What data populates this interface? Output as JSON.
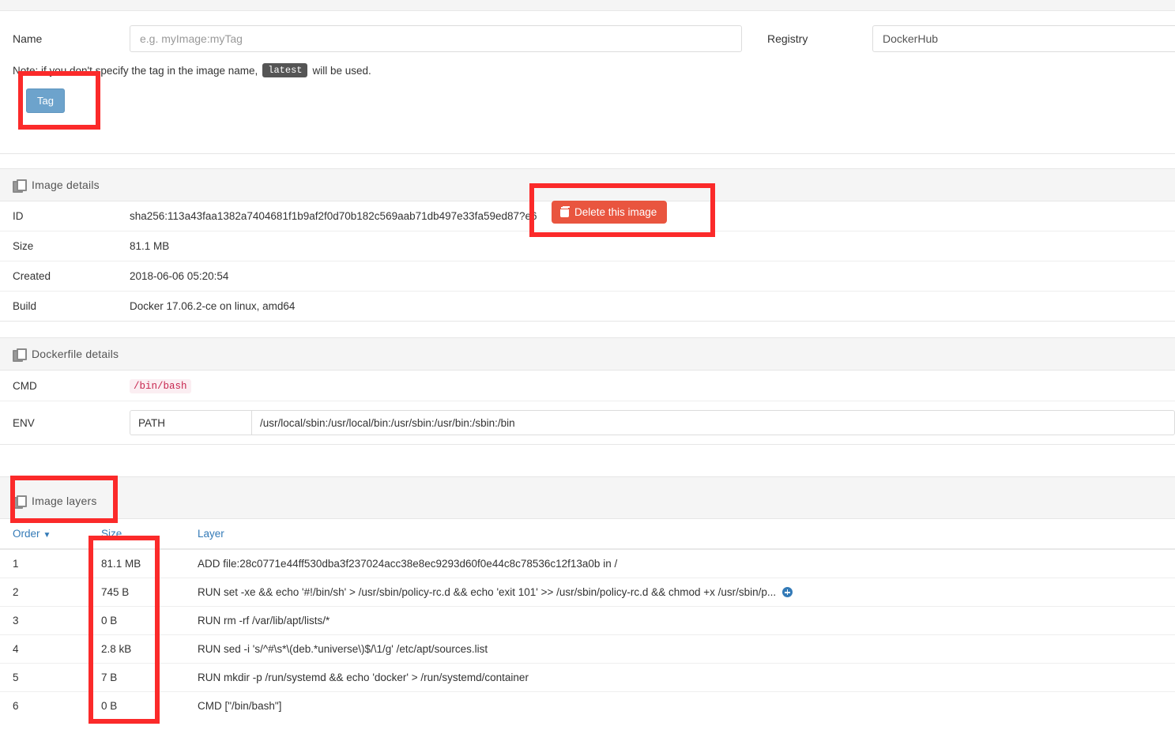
{
  "form": {
    "name_label": "Name",
    "name_placeholder": "e.g. myImage:myTag",
    "name_value": "",
    "registry_label": "Registry",
    "registry_value": "DockerHub",
    "note_prefix": "Note: if you don't specify the tag in the image name,",
    "note_badge": "latest",
    "note_suffix": "will be used.",
    "tag_button": "Tag"
  },
  "image_details": {
    "heading": "Image details",
    "heading_icon": "clone-icon",
    "delete_button": "Delete this image",
    "delete_icon": "trash-icon",
    "rows": [
      {
        "key": "ID",
        "value": "sha256:113a43faa1382a7404681f1b9af2f0d70b182c569aab71db497e33fa59ed87?e6"
      },
      {
        "key": "Size",
        "value": "81.1 MB"
      },
      {
        "key": "Created",
        "value": "2018-06-06 05:20:54"
      },
      {
        "key": "Build",
        "value": "Docker 17.06.2-ce on linux, amd64"
      }
    ]
  },
  "dockerfile_details": {
    "heading": "Dockerfile details",
    "heading_icon": "clone-icon",
    "cmd_label": "CMD",
    "cmd_value": "/bin/bash",
    "env_label": "ENV",
    "env_key": "PATH",
    "env_value": "/usr/local/sbin:/usr/local/bin:/usr/sbin:/usr/bin:/sbin:/bin"
  },
  "image_layers": {
    "heading": "Image layers",
    "heading_icon": "clone-icon",
    "columns": {
      "order": "Order",
      "order_sort_icon": "chevron-down-icon",
      "size": "Size",
      "layer": "Layer"
    },
    "rows": [
      {
        "order": "1",
        "size": "81.1 MB",
        "layer": "ADD file:28c0771e44ff530dba3f237024acc38e8ec9293d60f0e44c8c78536c12f13a0b in /",
        "expandable": false
      },
      {
        "order": "2",
        "size": "745 B",
        "layer": "RUN set -xe && echo '#!/bin/sh' > /usr/sbin/policy-rc.d && echo 'exit 101' >> /usr/sbin/policy-rc.d && chmod +x /usr/sbin/p...",
        "expandable": true
      },
      {
        "order": "3",
        "size": "0 B",
        "layer": "RUN rm -rf /var/lib/apt/lists/*",
        "expandable": false
      },
      {
        "order": "4",
        "size": "2.8 kB",
        "layer": "RUN sed -i 's/^#\\s*\\(deb.*universe\\)$/\\1/g' /etc/apt/sources.list",
        "expandable": false
      },
      {
        "order": "5",
        "size": "7 B",
        "layer": "RUN mkdir -p /run/systemd && echo 'docker' > /run/systemd/container",
        "expandable": false
      },
      {
        "order": "6",
        "size": "0 B",
        "layer": "CMD [\"/bin/bash\"]",
        "expandable": false
      }
    ]
  },
  "annotations": {
    "color": "#fb2a2a",
    "boxes": [
      "tag-button",
      "delete-this-image-button",
      "image-layers-heading",
      "size-column"
    ]
  }
}
